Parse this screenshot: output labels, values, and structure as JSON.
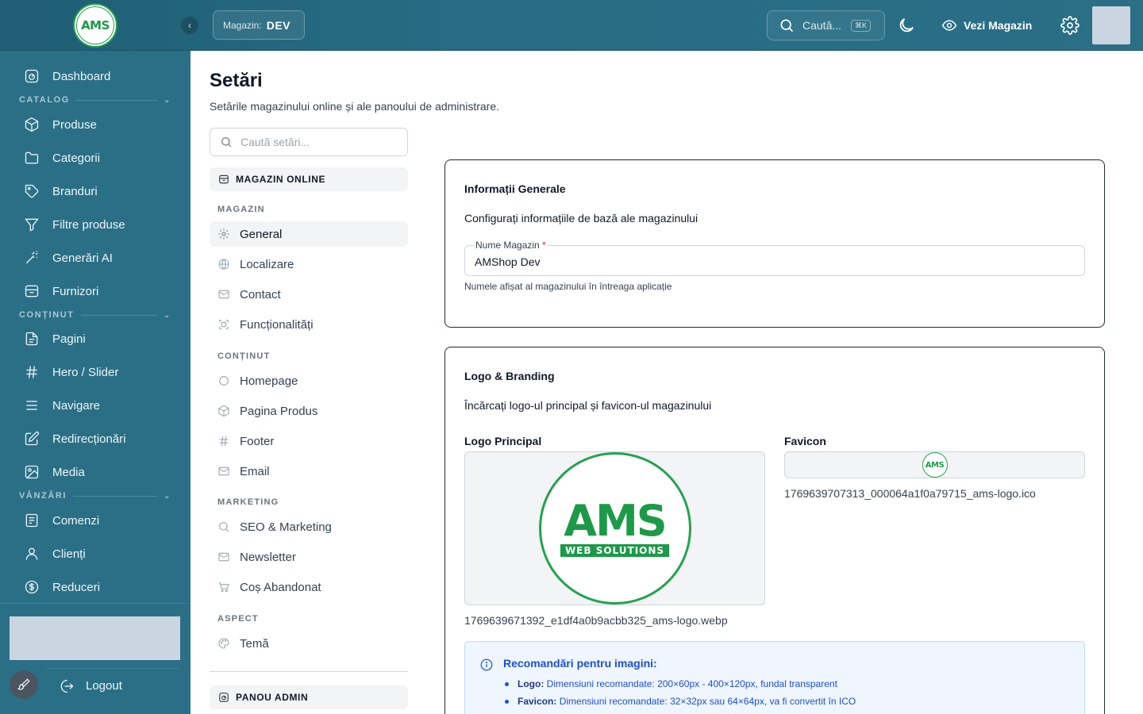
{
  "topbar": {
    "logo_text": "AMS",
    "store_label": "Magazin:",
    "store_value": "DEV",
    "search_placeholder": "Caută...",
    "search_shortcut": "⌘K",
    "view_store": "Vezi Magazin"
  },
  "sidebar": {
    "dashboard": "Dashboard",
    "sections": {
      "catalog": "CATALOG",
      "content": "CONȚINUT",
      "sales": "VÂNZĂRI"
    },
    "items": [
      {
        "label": "Produse",
        "icon": "box-icon"
      },
      {
        "label": "Categorii",
        "icon": "folder-icon"
      },
      {
        "label": "Branduri",
        "icon": "tag-icon"
      },
      {
        "label": "Filtre produse",
        "icon": "filter-icon"
      },
      {
        "label": "Generări AI",
        "icon": "magic-wand-icon"
      },
      {
        "label": "Furnizori",
        "icon": "store-icon"
      },
      {
        "label": "Pagini",
        "icon": "file-icon"
      },
      {
        "label": "Hero / Slider",
        "icon": "hash-icon"
      },
      {
        "label": "Navigare",
        "icon": "menu-icon"
      },
      {
        "label": "Redirecționări",
        "icon": "edit-square-icon"
      },
      {
        "label": "Media",
        "icon": "image-icon"
      },
      {
        "label": "Comenzi",
        "icon": "receipt-icon"
      },
      {
        "label": "Clienți",
        "icon": "user-icon"
      },
      {
        "label": "Reduceri",
        "icon": "dollar-circle-icon"
      }
    ],
    "logout": "Logout"
  },
  "page": {
    "title": "Setări",
    "subtitle": "Setările magazinului online și ale panoului de administrare."
  },
  "settings_nav": {
    "search_placeholder": "Caută setări...",
    "group_online": "MAGAZIN ONLINE",
    "sub_magazin": "MAGAZIN",
    "general": "General",
    "localizare": "Localizare",
    "contact": "Contact",
    "functionalitati": "Funcționalități",
    "sub_continut": "CONȚINUT",
    "homepage": "Homepage",
    "pagina_produs": "Pagina Produs",
    "footer": "Footer",
    "email": "Email",
    "sub_marketing": "MARKETING",
    "seo": "SEO & Marketing",
    "newsletter": "Newsletter",
    "cos_abandonat": "Coș Abandonat",
    "sub_aspect": "ASPECT",
    "tema": "Temă",
    "group_admin": "PANOU ADMIN"
  },
  "general_card": {
    "title": "Informații Generale",
    "description": "Configurați informațiile de bază ale magazinului",
    "field_label": "Nume Magazin",
    "field_required": "*",
    "field_value": "AMShop Dev",
    "field_help": "Numele afișat al magazinului în întreaga aplicație"
  },
  "branding_card": {
    "title": "Logo & Branding",
    "description": "Încărcați logo-ul principal și favicon-ul magazinului",
    "logo_label": "Logo Principal",
    "logo_text": "AMS",
    "logo_subtext": "WEB SOLUTIONS",
    "logo_file": "1769639671392_e1df4a0b9acbb325_ams-logo.webp",
    "favicon_label": "Favicon",
    "favicon_text": "AMS",
    "favicon_file": "1769639707313_000064a1f0a79715_ams-logo.ico",
    "info_title": "Recomandări pentru imagini:",
    "info_logo_key": "Logo:",
    "info_logo_text": "Dimensiuni recomandate: 200×60px - 400×120px, fundal transparent",
    "info_fav_key": "Favicon:",
    "info_fav_text": "Dimensiuni recomandate: 32×32px sau 64×64px, va fi convertit în ICO"
  },
  "colors": {
    "sidebar": "#2b6f86",
    "brand_green": "#1c9a48",
    "info_blue": "#1d4ed8"
  }
}
